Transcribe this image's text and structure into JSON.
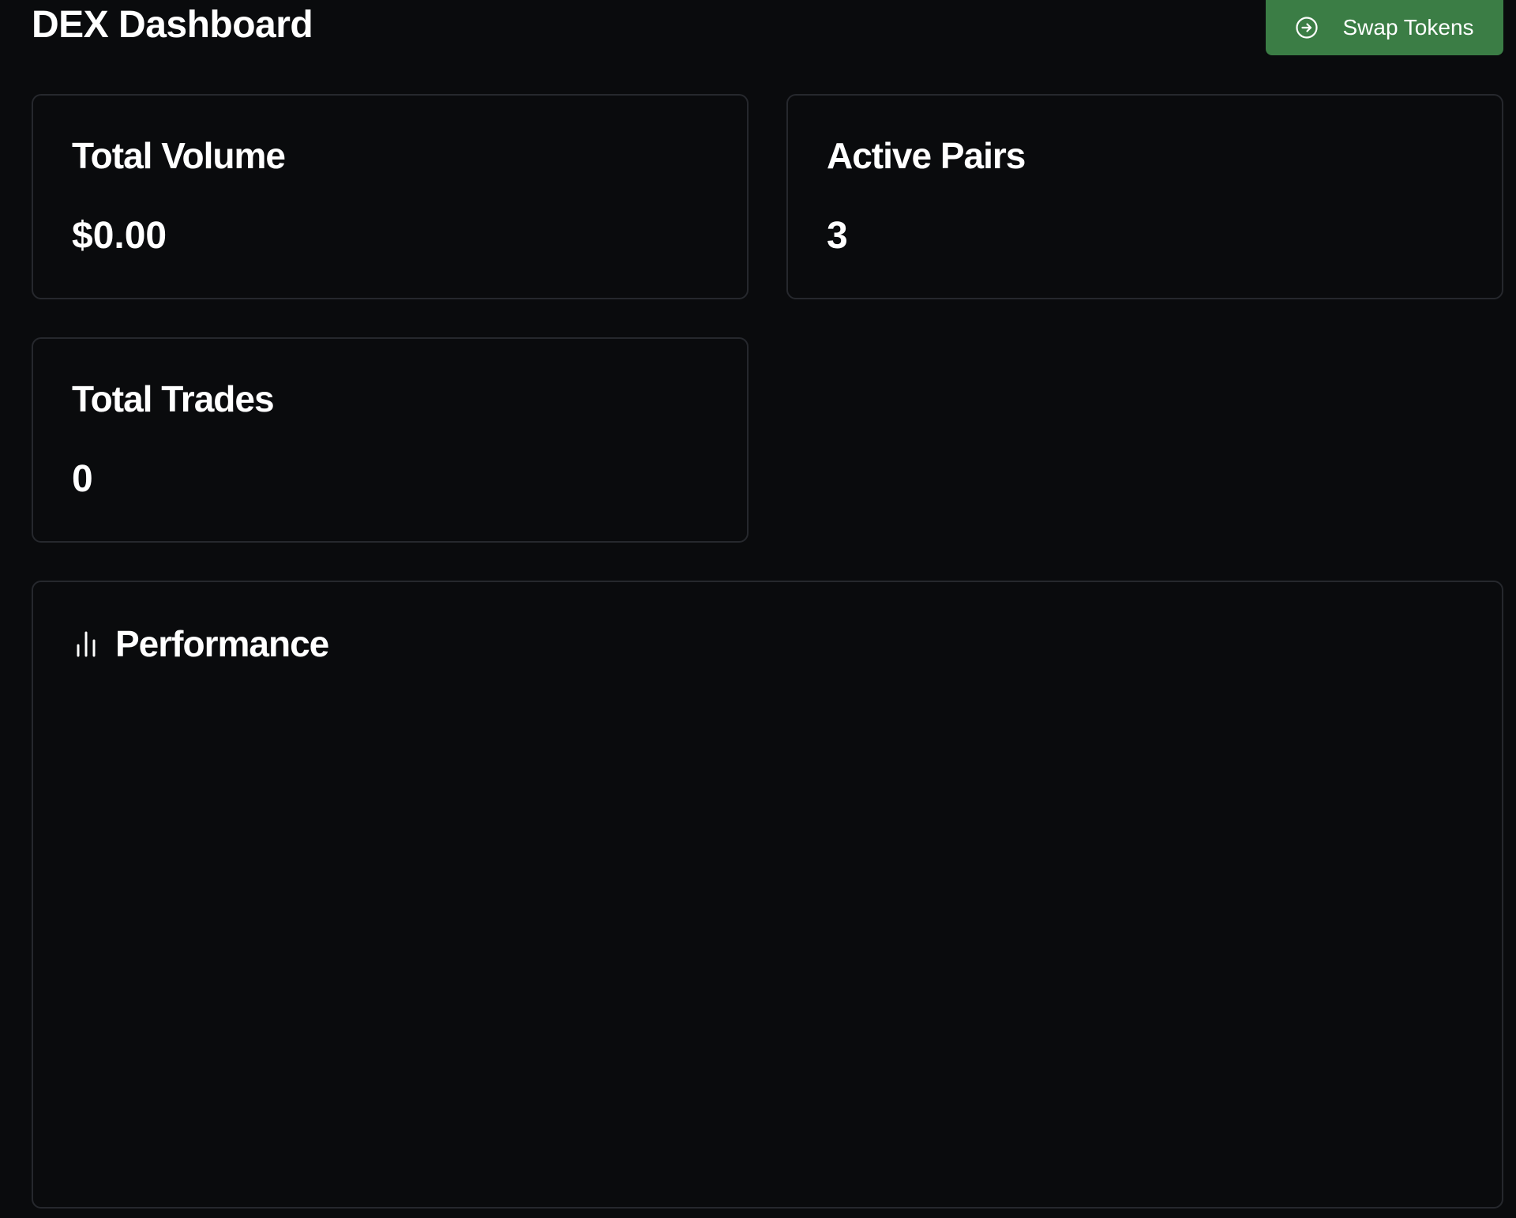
{
  "header": {
    "title": "DEX Dashboard",
    "swap_button_label": "Swap Tokens",
    "swap_button_icon": "arrow-right-circle-icon"
  },
  "stats": {
    "total_volume": {
      "label": "Total Volume",
      "value": "$0.00"
    },
    "active_pairs": {
      "label": "Active Pairs",
      "value": "3"
    },
    "total_trades": {
      "label": "Total Trades",
      "value": "0"
    }
  },
  "performance": {
    "title": "Performance",
    "icon": "bar-chart-icon"
  },
  "colors": {
    "background": "#0a0b0d",
    "card_border": "#26282d",
    "accent_button": "#3b7d45",
    "text": "#ffffff"
  }
}
